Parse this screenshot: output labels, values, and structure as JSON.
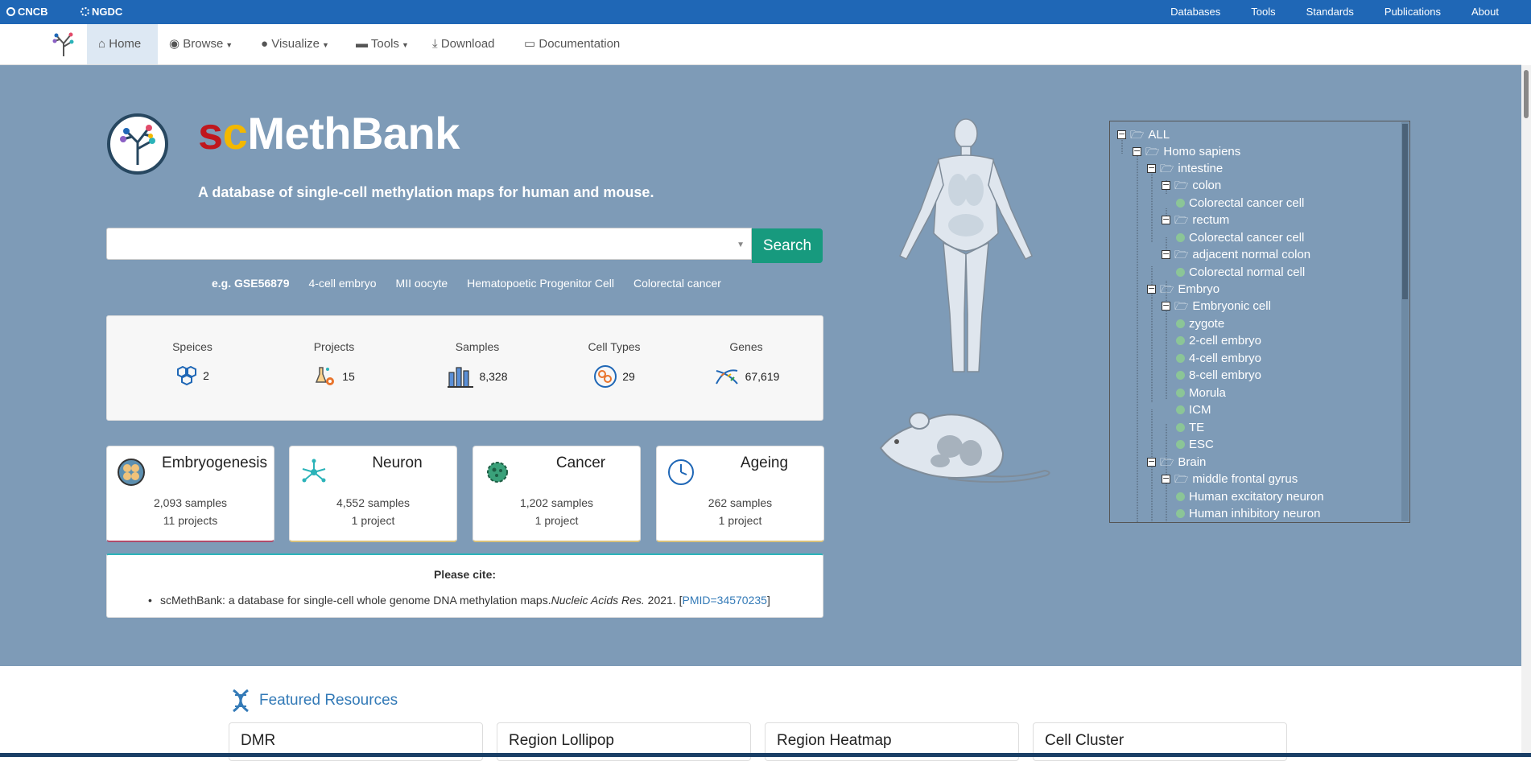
{
  "topbar": {
    "brand1": "CNCB",
    "brand2": "NGDC",
    "links": [
      "Databases",
      "Tools",
      "Standards",
      "Publications",
      "About"
    ]
  },
  "nav": {
    "home": "Home",
    "browse": "Browse",
    "visualize": "Visualize",
    "tools": "Tools",
    "download": "Download",
    "documentation": "Documentation"
  },
  "hero": {
    "title_s": "s",
    "title_c": "c",
    "title_rest": "MethBank",
    "tagline": "A database of single-cell methylation maps for human and mouse.",
    "search_placeholder": "",
    "search_button": "Search",
    "examples_label": "e.g. GSE56879",
    "examples": [
      "4-cell embryo",
      "MII oocyte",
      "Hematopoetic Progenitor Cell",
      "Colorectal cancer"
    ]
  },
  "stats": [
    {
      "label": "Speices",
      "value": "2"
    },
    {
      "label": "Projects",
      "value": "15"
    },
    {
      "label": "Samples",
      "value": "8,328"
    },
    {
      "label": "Cell Types",
      "value": "29"
    },
    {
      "label": "Genes",
      "value": "67,619"
    }
  ],
  "cards": [
    {
      "title": "Embryogenesis",
      "samples": "2,093 samples",
      "projects": "11 projects",
      "accent": "#b04a6a"
    },
    {
      "title": "Neuron",
      "samples": "4,552 samples",
      "projects": "1 project",
      "accent": "#d9c27a"
    },
    {
      "title": "Cancer",
      "samples": "1,202 samples",
      "projects": "1 project",
      "accent": "#d9c27a"
    },
    {
      "title": "Ageing",
      "samples": "262 samples",
      "projects": "1 project",
      "accent": "#d9c27a"
    }
  ],
  "cite": {
    "heading": "Please cite:",
    "text": "scMethBank: a database for single-cell whole genome DNA methylation maps.",
    "journal": "Nucleic Acids Res.",
    "year": " 2021. [",
    "pmid": "PMID=34570235",
    "end": "]"
  },
  "tree": [
    {
      "label": "ALL"
    },
    {
      "label": "Homo sapiens"
    },
    {
      "label": "intestine"
    },
    {
      "label": "colon"
    },
    {
      "label": "Colorectal cancer cell"
    },
    {
      "label": "rectum"
    },
    {
      "label": "Colorectal cancer cell"
    },
    {
      "label": "adjacent normal colon"
    },
    {
      "label": "Colorectal normal cell"
    },
    {
      "label": "Embryo"
    },
    {
      "label": "Embryonic cell"
    },
    {
      "label": "zygote"
    },
    {
      "label": "2-cell embryo"
    },
    {
      "label": "4-cell embryo"
    },
    {
      "label": "8-cell embryo"
    },
    {
      "label": "Morula"
    },
    {
      "label": "ICM"
    },
    {
      "label": "TE"
    },
    {
      "label": "ESC"
    },
    {
      "label": "Brain"
    },
    {
      "label": "middle frontal gyrus"
    },
    {
      "label": "Human excitatory neuron"
    },
    {
      "label": "Human inhibitory neuron"
    }
  ],
  "featured": {
    "title": "Featured Resources",
    "cards": [
      "DMR",
      "Region Lollipop",
      "Region Heatmap",
      "Cell Cluster"
    ]
  },
  "colors": {
    "topbar": "#1f67b6",
    "hero": "#7e9bb7",
    "search_button": "#179a7e",
    "link": "#337ab7"
  }
}
